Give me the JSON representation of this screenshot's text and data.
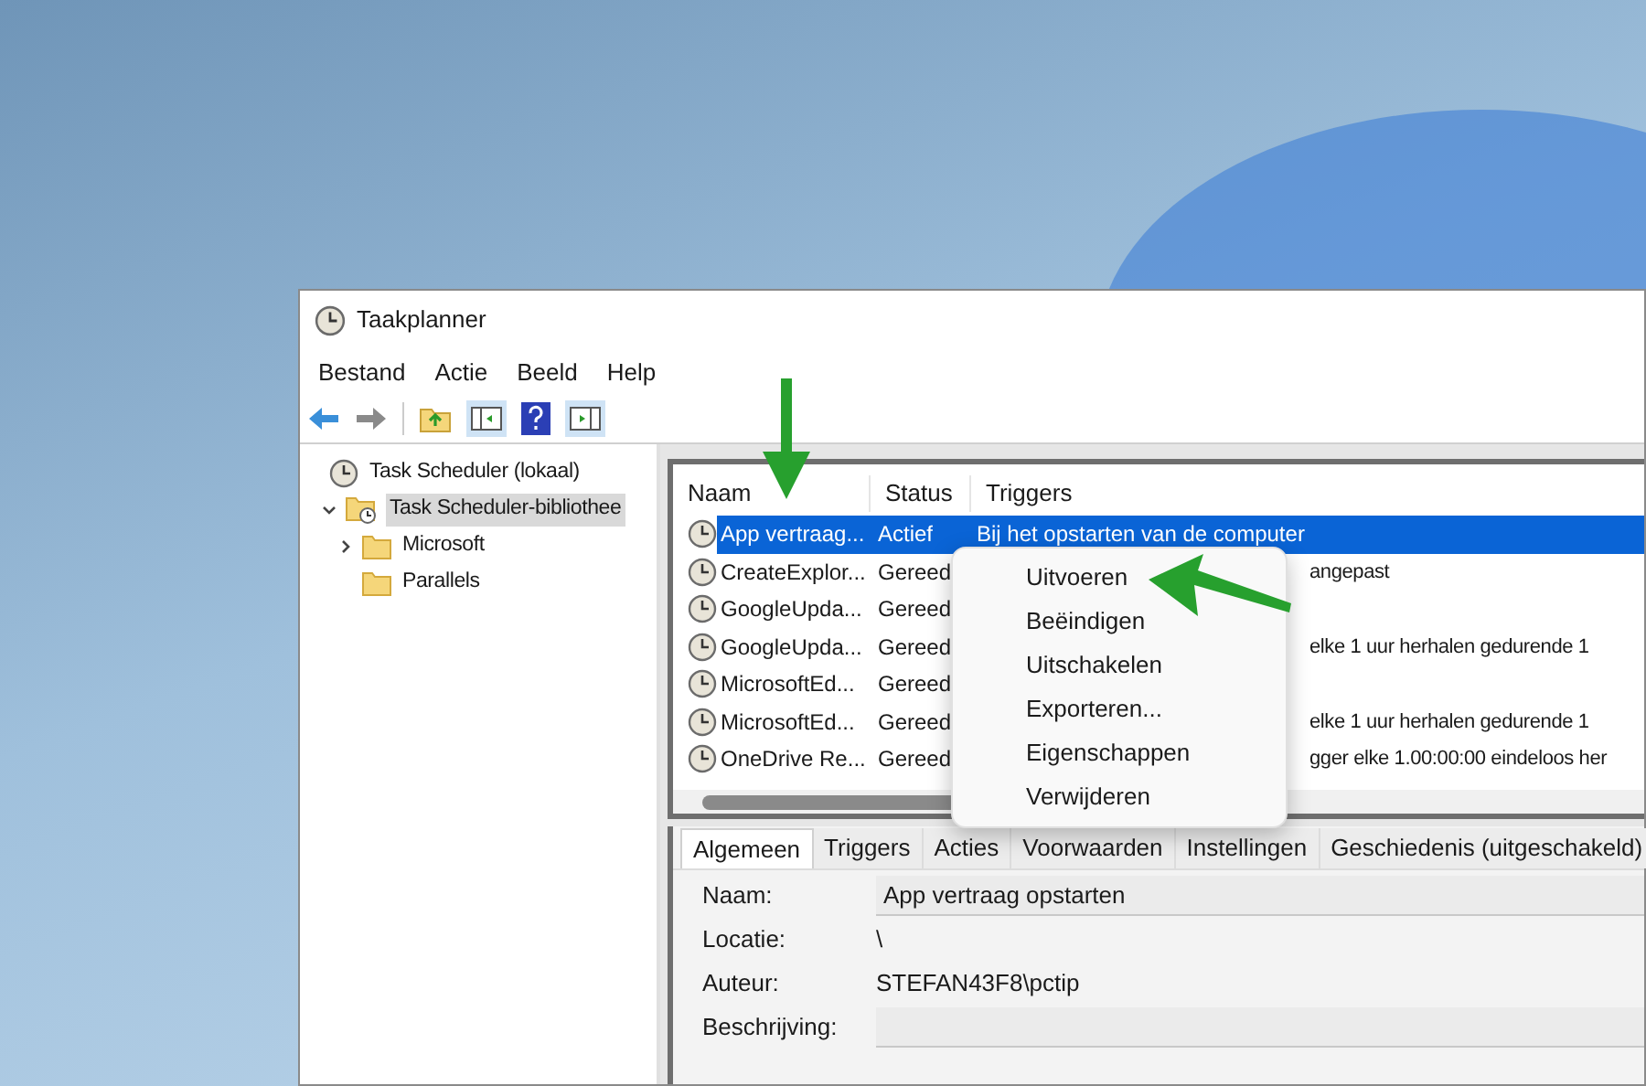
{
  "window": {
    "title": "Taakplanner"
  },
  "menu_bar": [
    "Bestand",
    "Actie",
    "Beeld",
    "Help"
  ],
  "tree": [
    {
      "label": "Task Scheduler (lokaal)",
      "selected": false,
      "children": [
        {
          "label": "Task Scheduler-bibliothee",
          "selected": true,
          "expanded": true,
          "children": [
            {
              "label": "Microsoft",
              "selected": false,
              "expanded": false
            },
            {
              "label": "Parallels",
              "selected": false
            }
          ]
        }
      ]
    }
  ],
  "task_table": {
    "columns": [
      "Naam",
      "Status",
      "Triggers"
    ],
    "rows": [
      {
        "name": "App vertraag...",
        "status": "Actief",
        "trigger": "Bij het opstarten van de computer",
        "selected": true
      },
      {
        "name": "CreateExplor...",
        "status": "Gereed",
        "trigger": "angepast",
        "selected": false
      },
      {
        "name": "GoogleUpda...",
        "status": "Gereed",
        "selected": false
      },
      {
        "name": "GoogleUpda...",
        "status": "Gereed",
        "trigger": "elke 1 uur herhalen gedurende 1",
        "selected": false
      },
      {
        "name": "MicrosoftEd...",
        "status": "Gereed",
        "selected": false
      },
      {
        "name": "MicrosoftEd...",
        "status": "Gereed",
        "trigger": "elke 1 uur herhalen gedurende 1",
        "selected": false
      },
      {
        "name": "OneDrive Re...",
        "status": "Gereed",
        "trigger": "gger elke 1.00:00:00 eindeloos her",
        "selected": false
      }
    ]
  },
  "context_menu": [
    "Uitvoeren",
    "Beëindigen",
    "Uitschakelen",
    "Exporteren...",
    "Eigenschappen",
    "Verwijderen"
  ],
  "detail_tabs": [
    {
      "label": "Algemeen",
      "selected": true
    },
    {
      "label": "Triggers",
      "selected": false
    },
    {
      "label": "Acties",
      "selected": false
    },
    {
      "label": "Voorwaarden",
      "selected": false
    },
    {
      "label": "Instellingen",
      "selected": false
    },
    {
      "label": "Geschiedenis (uitgeschakeld)",
      "selected": false
    }
  ],
  "detail_fields": [
    {
      "label": "Naam:",
      "value": "App vertraag opstarten",
      "kind": "field"
    },
    {
      "label": "Locatie:",
      "value": "\\",
      "kind": "text"
    },
    {
      "label": "Auteur:",
      "value": "STEFAN43F8\\pctip",
      "kind": "text"
    },
    {
      "label": "Beschrijving:",
      "kind": "field"
    }
  ]
}
